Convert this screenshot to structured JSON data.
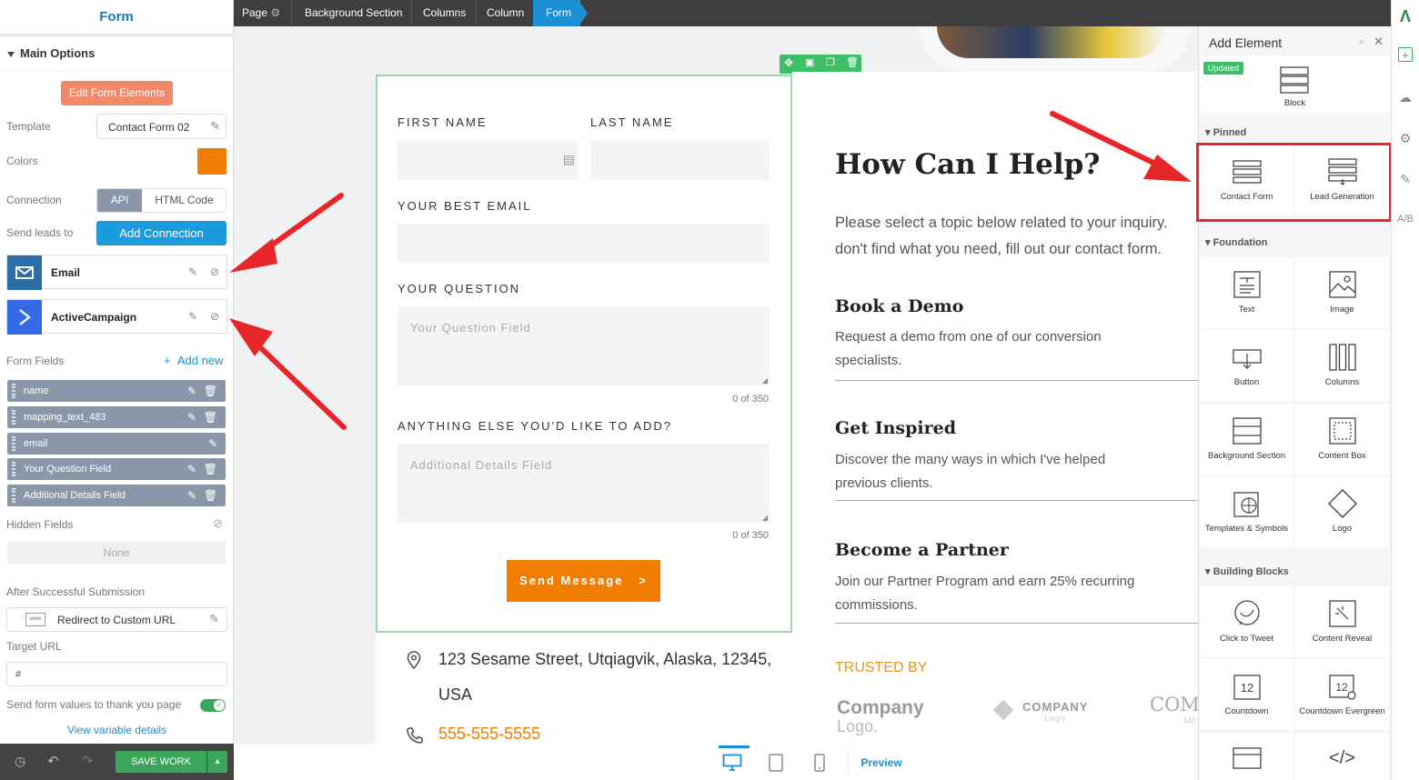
{
  "left_panel": {
    "title": "Form",
    "main_options": "Main Options",
    "edit_form_elements": "Edit Form Elements",
    "template_label": "Template",
    "template_value": "Contact Form 02",
    "colors_label": "Colors",
    "color_swatch": "#f07d00",
    "connection_label": "Connection",
    "connection_tabs": [
      "API",
      "HTML Code"
    ],
    "send_leads_label": "Send leads to",
    "add_connection": "Add Connection",
    "integrations": [
      {
        "name": "Email",
        "icon": "envelope-icon",
        "color": "#2c6fa6"
      },
      {
        "name": "ActiveCampaign",
        "icon": "activecampaign-icon",
        "color": "#356ae6"
      }
    ],
    "form_fields_label": "Form Fields",
    "add_new": "Add new",
    "fields": [
      "name",
      "mapping_text_483",
      "email",
      "Your Question Field",
      "Additional Details Field"
    ],
    "hidden_fields_label": "Hidden Fields",
    "hidden_fields_value": "None",
    "after_submission_label": "After Successful Submission",
    "redirect_option": "Redirect to Custom URL",
    "target_url_label": "Target URL",
    "target_url_value": "#",
    "send_values_label": "Send form values to thank you page",
    "view_variable_details": "View variable details",
    "save_work": "SAVE WORK"
  },
  "breadcrumb": [
    "Page",
    "Background Section",
    "Columns",
    "Column",
    "Form"
  ],
  "form": {
    "first_name": "FIRST NAME",
    "last_name": "LAST NAME",
    "email_label": "YOUR BEST EMAIL",
    "question_label": "YOUR QUESTION",
    "question_placeholder": "Your Question Field",
    "question_counter": "0 of 350",
    "extra_label": "ANYTHING ELSE YOU'D LIKE TO ADD?",
    "extra_placeholder": "Additional Details Field",
    "extra_counter": "0 of 350",
    "submit": "Send Message",
    "submit_arrow": ">"
  },
  "contact": {
    "address": "123 Sesame Street, Utqiagvik, Alaska, 12345,",
    "address2": "USA",
    "phone": "555-555-5555"
  },
  "content": {
    "heading": "How Can I Help?",
    "intro1": "Please select a topic below related to your inquiry.",
    "intro2": "don't find what you need, fill out our contact form.",
    "sections": [
      {
        "title": "Book a Demo",
        "line1": "Request a demo from one of our conversion",
        "line2": "specialists."
      },
      {
        "title": "Get Inspired",
        "line1": "Discover the many ways in which I've helped",
        "line2": "previous clients."
      },
      {
        "title": "Become a Partner",
        "line1": "Join our Partner Program and earn 25% recurring",
        "line2": "commissions."
      }
    ],
    "trusted_by": "TRUSTED BY",
    "logos": [
      "Company",
      "Logo.",
      "COMPANY",
      "Logo",
      "COM",
      "LO"
    ]
  },
  "device_bar": {
    "preview": "Preview"
  },
  "add_element": {
    "title": "Add Element",
    "updated_badge": "Updated",
    "block": "Block",
    "pinned_label": "Pinned",
    "pinned": [
      "Contact Form",
      "Lead Generation"
    ],
    "foundation_label": "Foundation",
    "foundation": [
      "Text",
      "Image",
      "Button",
      "Columns",
      "Background Section",
      "Content Box",
      "Templates & Symbols",
      "Logo"
    ],
    "building_label": "Building Blocks",
    "building": [
      "Click to Tweet",
      "Content Reveal",
      "Countdown",
      "Countdown Evergreen"
    ]
  },
  "colors": {
    "accent": "#1b8fd4",
    "orange": "#f07d00",
    "red_arrow": "#e8262a",
    "green": "#3ba55d"
  }
}
